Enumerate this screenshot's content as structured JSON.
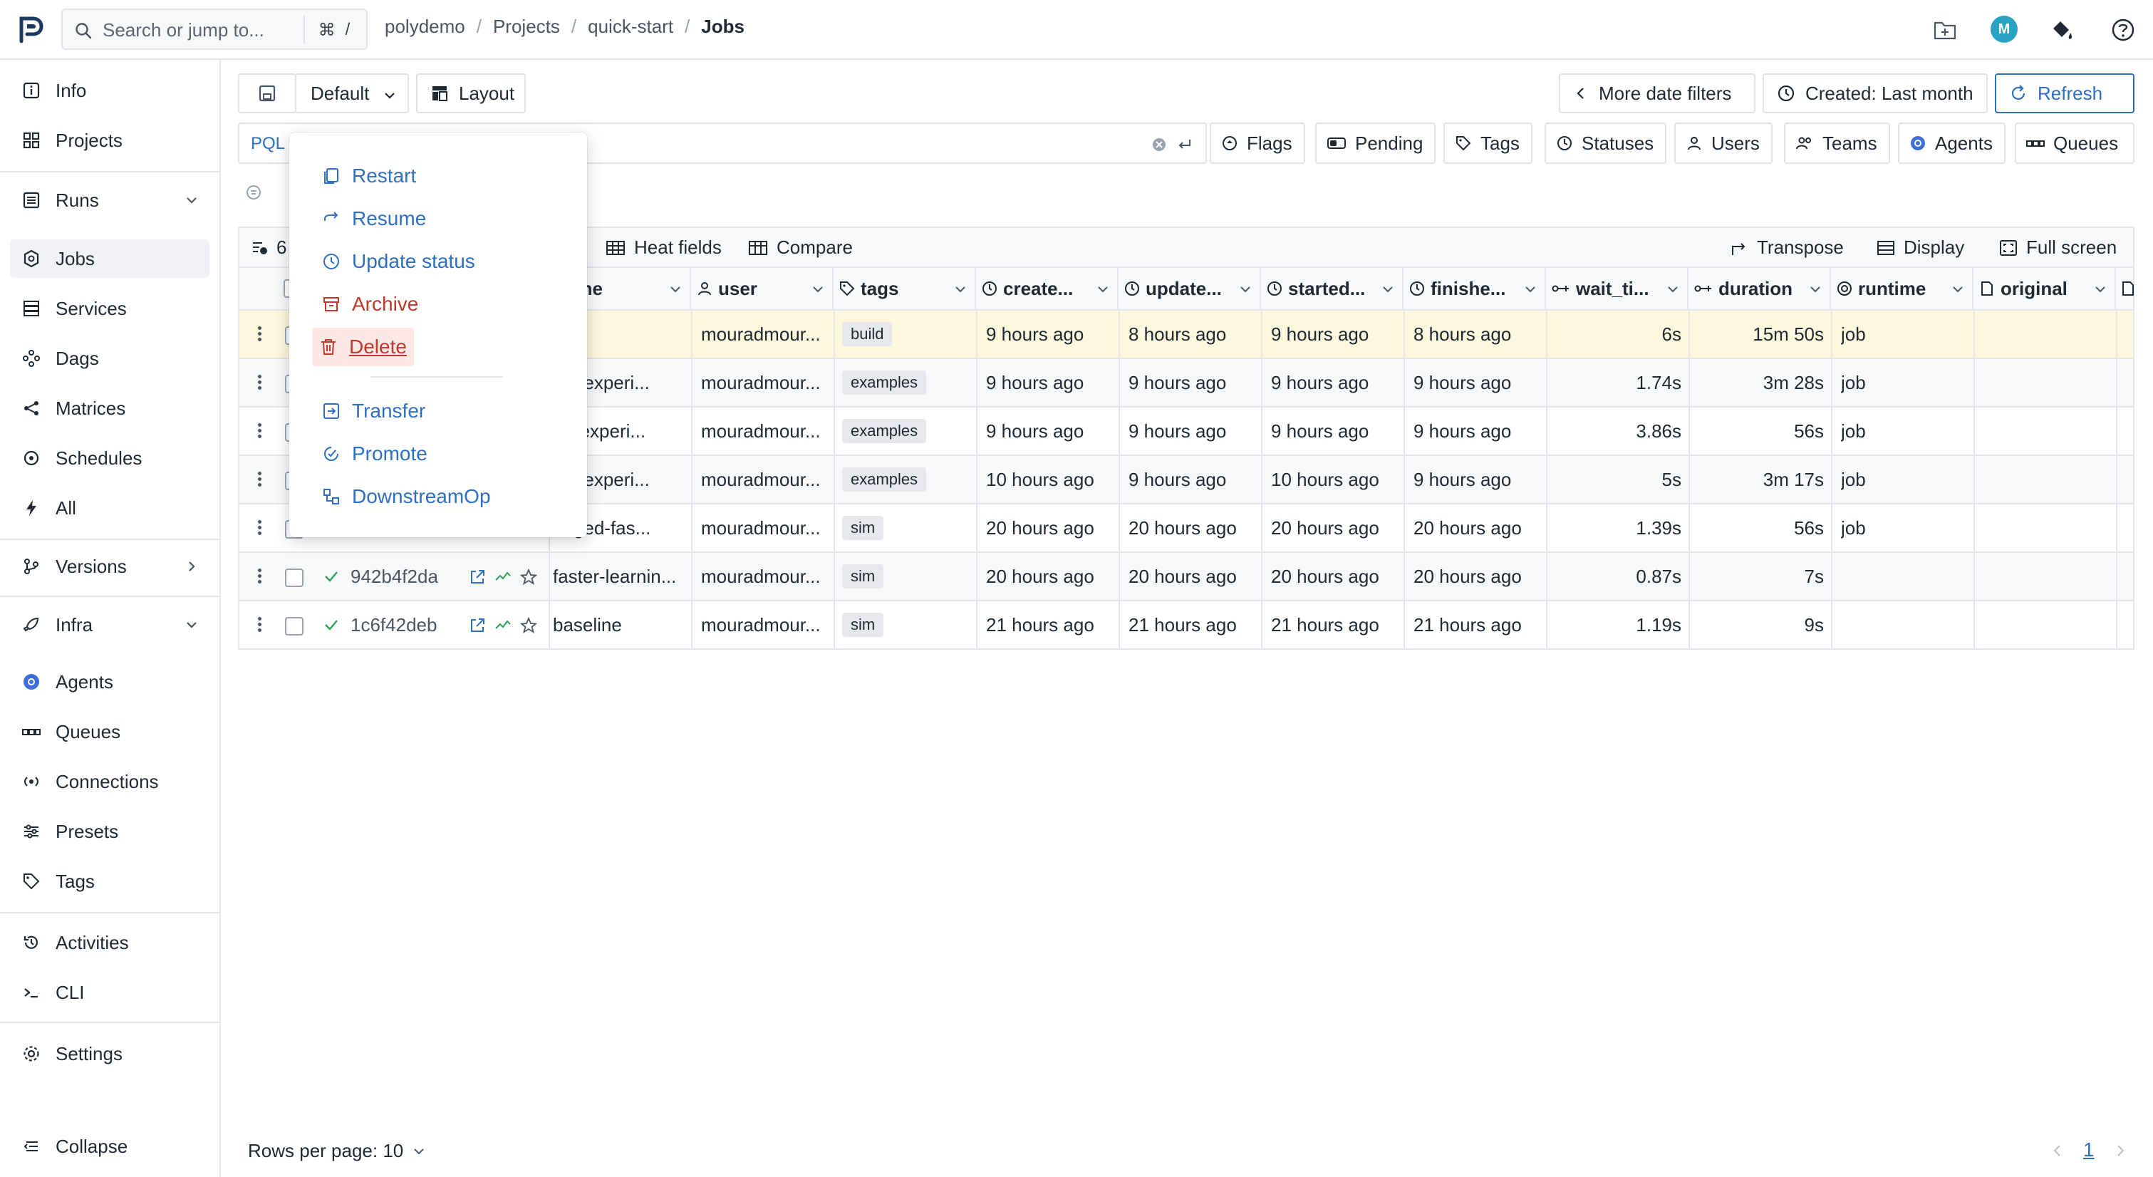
{
  "topbar": {
    "search_placeholder": "Search or jump to...",
    "shortcut_key": "⌘",
    "shortcut_slash": "/",
    "breadcrumb": [
      "polydemo",
      "Projects",
      "quick-start",
      "Jobs"
    ],
    "avatar_initial": "M"
  },
  "sidebar": {
    "items": [
      {
        "label": "Info",
        "icon": "info-icon"
      },
      {
        "label": "Projects",
        "icon": "grid-icon"
      },
      {
        "label": "Runs",
        "icon": "runs-icon"
      },
      {
        "label": "Jobs",
        "icon": "jobs-icon"
      },
      {
        "label": "Services",
        "icon": "services-icon"
      },
      {
        "label": "Dags",
        "icon": "dags-icon"
      },
      {
        "label": "Matrices",
        "icon": "matrices-icon"
      },
      {
        "label": "Schedules",
        "icon": "schedules-icon"
      },
      {
        "label": "All",
        "icon": "bolt-icon"
      },
      {
        "label": "Versions",
        "icon": "versions-icon"
      },
      {
        "label": "Infra",
        "icon": "rocket-icon"
      },
      {
        "label": "Agents",
        "icon": "agents-icon"
      },
      {
        "label": "Queues",
        "icon": "queues-icon"
      },
      {
        "label": "Connections",
        "icon": "connections-icon"
      },
      {
        "label": "Presets",
        "icon": "presets-icon"
      },
      {
        "label": "Tags",
        "icon": "tag-icon"
      },
      {
        "label": "Activities",
        "icon": "history-icon"
      },
      {
        "label": "CLI",
        "icon": "terminal-icon"
      },
      {
        "label": "Settings",
        "icon": "settings-icon"
      },
      {
        "label": "Collapse",
        "icon": "collapse-icon"
      }
    ]
  },
  "toolbar": {
    "preset_label": "Default",
    "layout_label": "Layout",
    "more_date_filters": "More date filters",
    "created_filter": "Created: Last month",
    "refresh_label": "Refresh",
    "pql_label": "PQL",
    "filters": [
      "Flags",
      "Pending",
      "Tags",
      "Statuses",
      "Users",
      "Teams",
      "Agents",
      "Queues"
    ]
  },
  "tablebar": {
    "count_label": "6",
    "heat_fields": "Heat fields",
    "compare": "Compare",
    "transpose": "Transpose",
    "display": "Display",
    "full_screen": "Full screen"
  },
  "columns": [
    "name",
    "user",
    "tags",
    "create...",
    "update...",
    "started...",
    "finishe...",
    "wait_ti...",
    "duration",
    "runtime",
    "original"
  ],
  "rows": [
    {
      "uuid": "",
      "name": "d",
      "user": "mouradmour...",
      "tag": "build",
      "created": "9 hours ago",
      "updated": "8 hours ago",
      "started": "9 hours ago",
      "finished": "8 hours ago",
      "wait": "6s",
      "duration": "15m 50s",
      "runtime": "job"
    },
    {
      "uuid": "",
      "name": "ple-experi...",
      "user": "mouradmour...",
      "tag": "examples",
      "created": "9 hours ago",
      "updated": "9 hours ago",
      "started": "9 hours ago",
      "finished": "9 hours ago",
      "wait": "1.74s",
      "duration": "3m 28s",
      "runtime": "job"
    },
    {
      "uuid": "",
      "name": "ed-experi...",
      "user": "mouradmour...",
      "tag": "examples",
      "created": "9 hours ago",
      "updated": "9 hours ago",
      "started": "9 hours ago",
      "finished": "9 hours ago",
      "wait": "3.86s",
      "duration": "56s",
      "runtime": "job"
    },
    {
      "uuid": "",
      "name": "ple-experi...",
      "user": "mouradmour...",
      "tag": "examples",
      "created": "10 hours ago",
      "updated": "9 hours ago",
      "started": "10 hours ago",
      "finished": "9 hours ago",
      "wait": "5s",
      "duration": "3m 17s",
      "runtime": "job"
    },
    {
      "uuid": "",
      "name": "naged-fas...",
      "user": "mouradmour...",
      "tag": "sim",
      "created": "20 hours ago",
      "updated": "20 hours ago",
      "started": "20 hours ago",
      "finished": "20 hours ago",
      "wait": "1.39s",
      "duration": "56s",
      "runtime": "job"
    },
    {
      "uuid": "942b4f2da",
      "name": "faster-learnin...",
      "user": "mouradmour...",
      "tag": "sim",
      "created": "20 hours ago",
      "updated": "20 hours ago",
      "started": "20 hours ago",
      "finished": "20 hours ago",
      "wait": "0.87s",
      "duration": "7s",
      "runtime": ""
    },
    {
      "uuid": "1c6f42deb",
      "name": "baseline",
      "user": "mouradmour...",
      "tag": "sim",
      "created": "21 hours ago",
      "updated": "21 hours ago",
      "started": "21 hours ago",
      "finished": "21 hours ago",
      "wait": "1.19s",
      "duration": "9s",
      "runtime": ""
    }
  ],
  "context_menu": {
    "items": [
      "Restart",
      "Resume",
      "Update status",
      "Archive",
      "Delete",
      "Transfer",
      "Promote",
      "DownstreamOp"
    ]
  },
  "footer": {
    "rows_per_page": "Rows per page: 10",
    "page": "1"
  },
  "colors": {
    "accent": "#2f6fbf",
    "danger": "#c0392b",
    "highlight_row": "#fcf7dd",
    "success": "#2e9e5b"
  }
}
